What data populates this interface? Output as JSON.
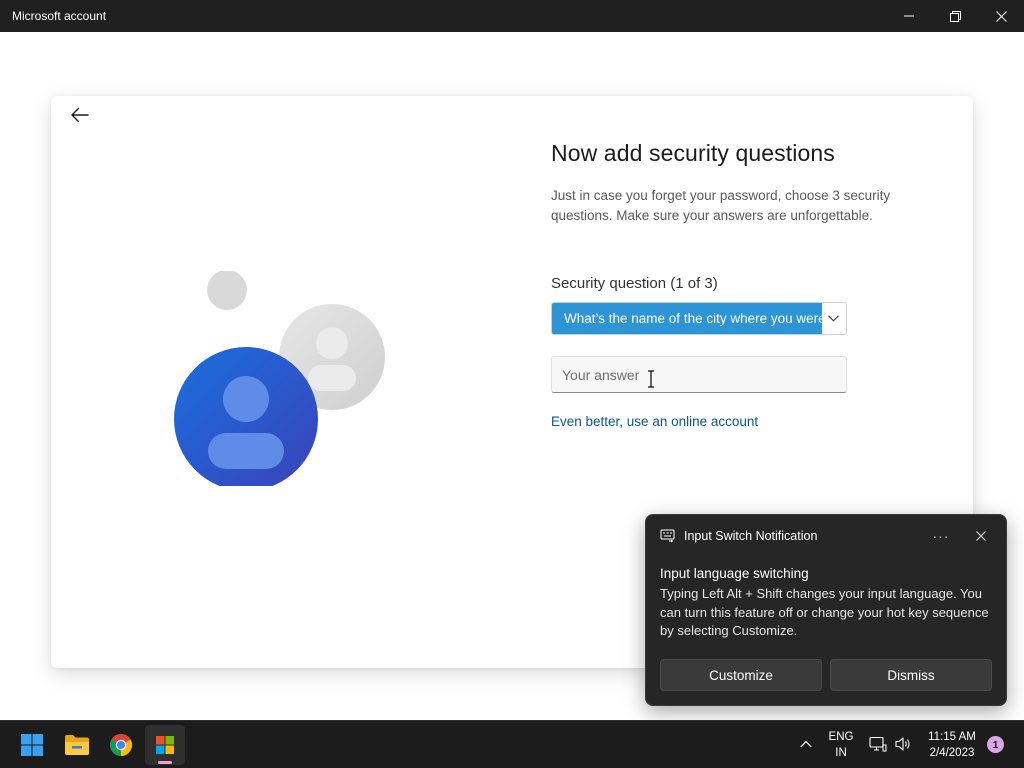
{
  "window": {
    "title": "Microsoft account"
  },
  "content": {
    "heading": "Now add security questions",
    "description": "Just in case you forget your password, choose 3 security questions. Make sure your answers are unforgettable.",
    "question_label": "Security question (1 of 3)",
    "question_selected": "What’s the name of the city where you were born?",
    "answer_placeholder": "Your answer",
    "answer_value": "",
    "online_account_link": "Even better, use an online account"
  },
  "notification": {
    "app_name": "Input Switch Notification",
    "more_label": "···",
    "title": "Input language switching",
    "body": "Typing Left Alt + Shift changes your input language. You can turn this feature off or change your hot key sequence by selecting Customize.",
    "buttons": [
      {
        "label": "Customize"
      },
      {
        "label": "Dismiss"
      }
    ]
  },
  "taskbar": {
    "apps": [
      {
        "name": "start",
        "icon": "windows-logo-icon"
      },
      {
        "name": "file-explorer",
        "icon": "folder-icon"
      },
      {
        "name": "chrome",
        "icon": "chrome-icon"
      },
      {
        "name": "microsoft-store",
        "icon": "store-icon",
        "active": true
      }
    ],
    "language": {
      "line1": "ENG",
      "line2": "IN"
    },
    "clock": {
      "time": "11:15 AM",
      "date": "2/4/2023"
    },
    "notification_count": "1"
  },
  "colors": {
    "accent": "#2d95d6",
    "link": "#0c5693",
    "avatar_front": "#1f5fd1",
    "taskbar_bg": "#1c1c1c",
    "titlebar_bg": "#202020"
  }
}
